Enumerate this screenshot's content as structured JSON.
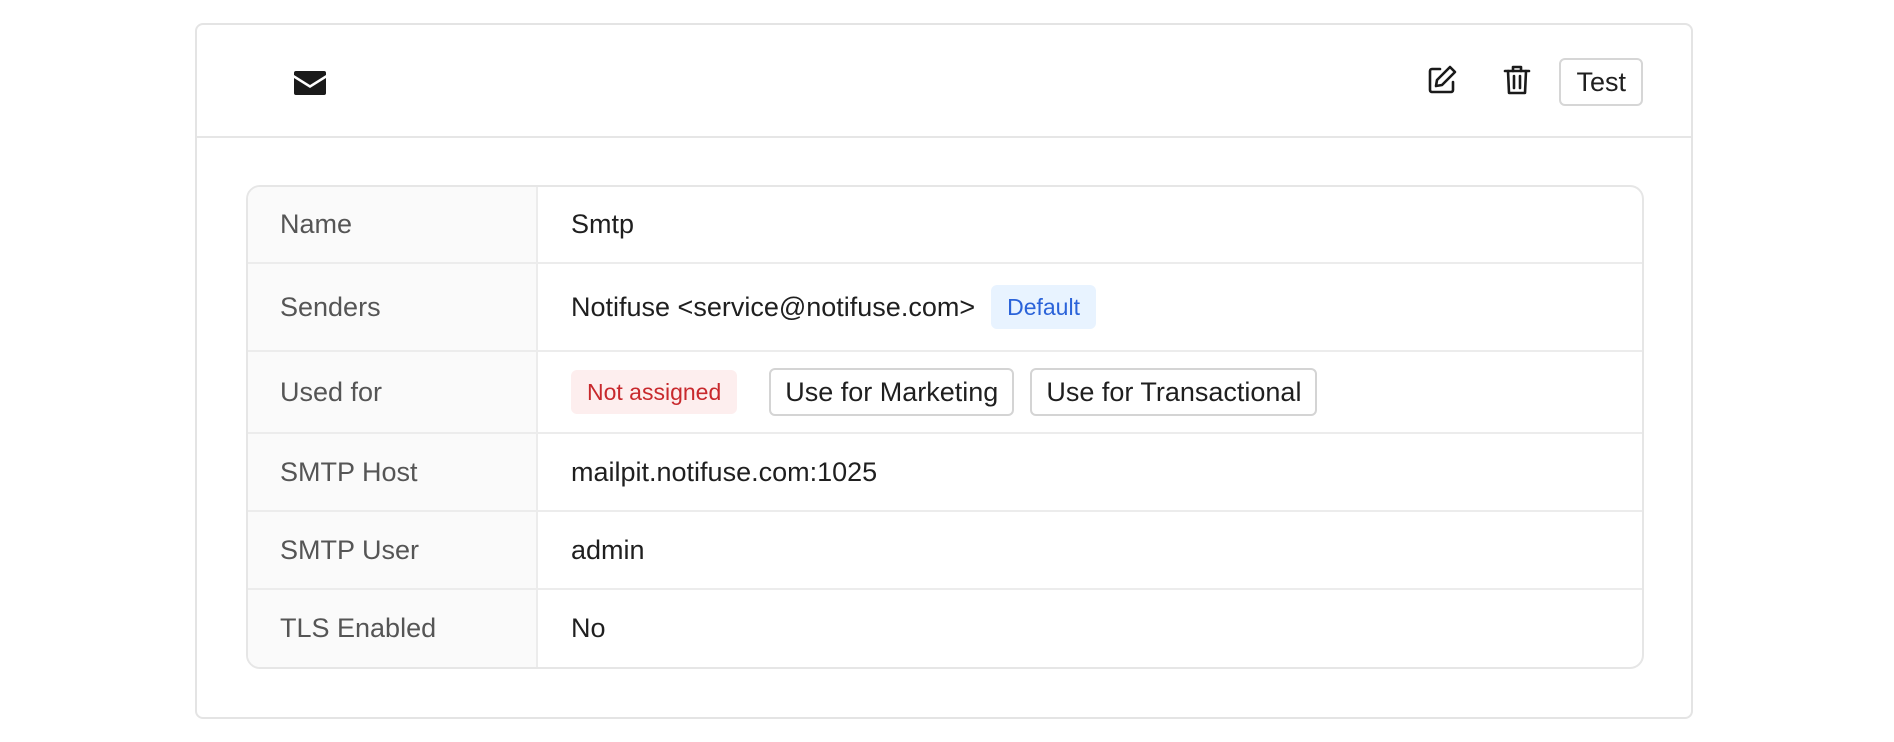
{
  "header": {
    "provider_icon": "envelope-icon",
    "actions": {
      "edit_icon": "edit-icon",
      "delete_icon": "trash-icon",
      "test_label": "Test"
    }
  },
  "details": {
    "name": {
      "label": "Name",
      "value": "Smtp"
    },
    "senders": {
      "label": "Senders",
      "value": "Notifuse <service@notifuse.com>",
      "badge": "Default"
    },
    "used_for": {
      "label": "Used for",
      "status": "Not assigned",
      "marketing_button": "Use for Marketing",
      "transactional_button": "Use for Transactional"
    },
    "smtp_host": {
      "label": "SMTP Host",
      "value": "mailpit.notifuse.com:1025"
    },
    "smtp_user": {
      "label": "SMTP User",
      "value": "admin"
    },
    "tls_enabled": {
      "label": "TLS Enabled",
      "value": "No"
    }
  },
  "colors": {
    "default_badge_bg": "#e8f3ff",
    "default_badge_text": "#2b63d9",
    "not_assigned_bg": "#fdeeee",
    "not_assigned_text": "#c8292d"
  }
}
